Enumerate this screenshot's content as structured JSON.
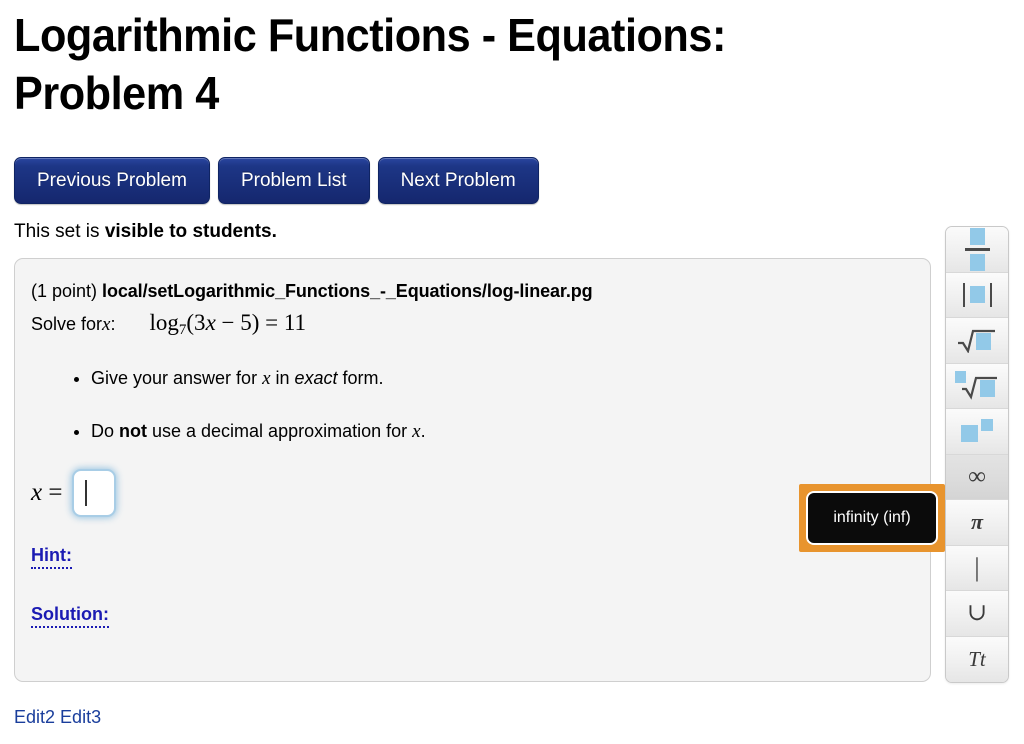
{
  "page": {
    "title": "Logarithmic Functions - Equations: Problem 4"
  },
  "nav": {
    "previous_label": "Previous Problem",
    "problem_list_label": "Problem List",
    "next_label": "Next Problem"
  },
  "status": {
    "prefix": "This set is ",
    "emphasis": "visible to students."
  },
  "problem": {
    "points": "(1 point) ",
    "source": "local/setLogarithmic_Functions_-_Equations/log-linear.pg",
    "solve_label": "Solve for ",
    "solve_var": "x",
    "solve_colon": ":",
    "equation": {
      "log": "log",
      "base": "7",
      "open": "(3",
      "var": "x",
      "rest": " − 5) = 11"
    },
    "bullets": [
      {
        "parts": [
          {
            "text": "Give your answer for ",
            "style": "normal"
          },
          {
            "text": "x",
            "style": "math"
          },
          {
            "text": " in ",
            "style": "normal"
          },
          {
            "text": "exact",
            "style": "italic"
          },
          {
            "text": " form.",
            "style": "normal"
          }
        ]
      },
      {
        "parts": [
          {
            "text": "Do ",
            "style": "normal"
          },
          {
            "text": "not",
            "style": "bold"
          },
          {
            "text": " use a decimal approximation for ",
            "style": "normal"
          },
          {
            "text": "x",
            "style": "math"
          },
          {
            "text": ".",
            "style": "normal"
          }
        ]
      }
    ],
    "answer": {
      "var": "x",
      "equals": " = ",
      "value": "",
      "placeholder": ""
    },
    "hint_label": "Hint:",
    "solution_label": "Solution:"
  },
  "footer": {
    "edit2_label": "Edit2",
    "edit3_label": "Edit3"
  },
  "palette": {
    "buttons": [
      {
        "name": "fraction",
        "glyph": ""
      },
      {
        "name": "absolute-value",
        "glyph": ""
      },
      {
        "name": "square-root",
        "glyph": ""
      },
      {
        "name": "nth-root",
        "glyph": ""
      },
      {
        "name": "exponent",
        "glyph": ""
      },
      {
        "name": "infinity",
        "glyph": "∞"
      },
      {
        "name": "pi",
        "glyph": "π"
      },
      {
        "name": "vertical-bar",
        "glyph": "|"
      },
      {
        "name": "union",
        "glyph": "∪"
      },
      {
        "name": "text-mode",
        "glyph": "Tt"
      }
    ]
  },
  "tooltip": {
    "text": "infinity (inf)"
  },
  "colors": {
    "button_blue": "#1d3686",
    "link_blue": "#1a3e9c",
    "hint_blue": "#1b1bb3",
    "highlight_orange": "#e8942e",
    "icon_blue": "#92c9e8",
    "panel_bg": "#f4f4f4"
  }
}
